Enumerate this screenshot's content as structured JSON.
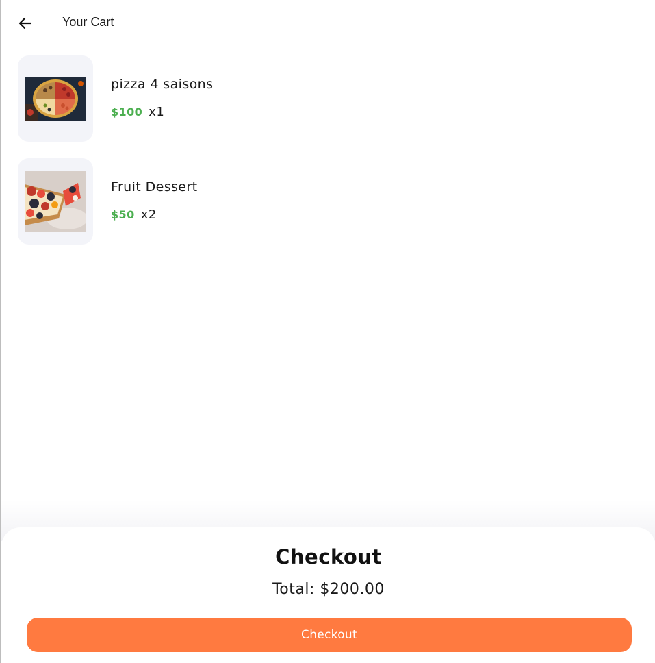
{
  "app_bar": {
    "title": "Your Cart",
    "back_icon": "arrow-left-icon"
  },
  "cart": {
    "items": [
      {
        "name": "pizza 4 saisons",
        "price": "$100",
        "quantity": "x1",
        "image": "pizza-photo"
      },
      {
        "name": "Fruit Dessert",
        "price": "$50",
        "quantity": "x2",
        "image": "fruit-tart-photo"
      }
    ]
  },
  "checkout": {
    "heading": "Checkout",
    "total": "Total: $200.00",
    "button_label": "Checkout"
  },
  "colors": {
    "accent": "#ff7a40",
    "price_green": "#4caf50",
    "thumb_background": "#f3f4f9"
  }
}
